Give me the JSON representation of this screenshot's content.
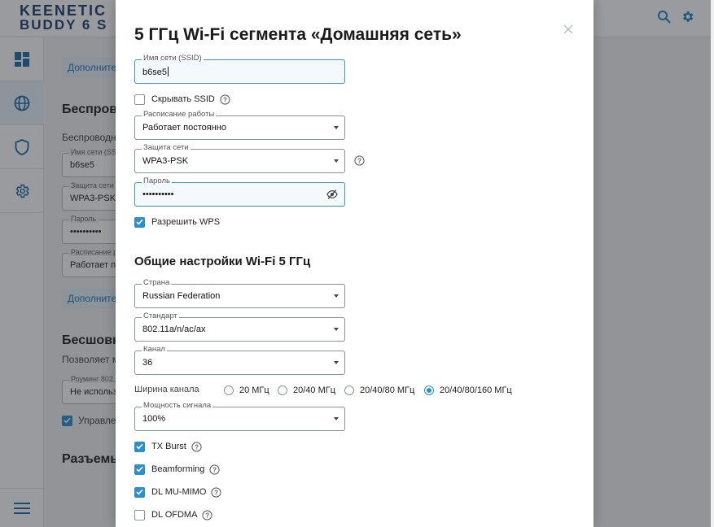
{
  "app": {
    "logo_line1": "KEENETIC",
    "logo_line2": "BUDDY 6 S",
    "top_icons": [
      "search-icon",
      "gear-icon"
    ],
    "sidebar_icons": [
      "dashboard-icon",
      "globe-icon",
      "shield-icon",
      "gear-icon",
      "menu-icon"
    ]
  },
  "background": {
    "link_more_top": "Дополнитель",
    "heading_wireless": "Беспрово",
    "text_wireless": "Беспроводная",
    "ssid_label": "Имя сети (SSI",
    "ssid_value": "b6se5",
    "security_label": "Защита сети",
    "security_value": "WPA3-PSK",
    "password_label": "Пароль",
    "password_value": "••••••••••",
    "schedule_label": "Расписание р",
    "schedule_value": "Работает по",
    "link_more_mid": "Дополнитель",
    "heading_seamless": "Бесшовны",
    "text_seamless": "Позволяет мо",
    "roaming_label": "Роуминг 802.",
    "roaming_value": "Не использо",
    "manage_label": "Управлен",
    "heading_ports": "Разъемы"
  },
  "modal": {
    "title": "5 ГГц Wi-Fi сегмента «Домашняя сеть»",
    "ssid": {
      "label": "Имя сети (SSID)",
      "value": "b6se5"
    },
    "hide_ssid": {
      "label": "Скрывать SSID",
      "checked": false
    },
    "schedule": {
      "label": "Расписание работы",
      "value": "Работает постоянно"
    },
    "security": {
      "label": "Защита сети",
      "value": "WPA3-PSK"
    },
    "password": {
      "label": "Пароль",
      "value": "••••••••••"
    },
    "wps": {
      "label": "Разрешить WPS",
      "checked": true
    },
    "general_title": "Общие настройки Wi-Fi 5 ГГц",
    "country": {
      "label": "Страна",
      "value": "Russian Federation"
    },
    "standard": {
      "label": "Стандарт",
      "value": "802.11a/n/ac/ax"
    },
    "channel": {
      "label": "Канал",
      "value": "36"
    },
    "channel_width": {
      "label": "Ширина канала",
      "options": [
        "20 МГц",
        "20/40 МГц",
        "20/40/80 МГц",
        "20/40/80/160 МГц"
      ],
      "selected": "20/40/80/160 МГц"
    },
    "power": {
      "label": "Мощность сигнала",
      "value": "100%"
    },
    "tx_burst": {
      "label": "TX Burst",
      "checked": true
    },
    "beamforming": {
      "label": "Beamforming",
      "checked": true
    },
    "dl_mu_mimo": {
      "label": "DL MU-MIMO",
      "checked": true
    },
    "dl_ofdma": {
      "label": "DL OFDMA",
      "checked": false
    }
  },
  "colors": {
    "accent": "#2b8fd1",
    "brand": "#1b3f6e"
  }
}
